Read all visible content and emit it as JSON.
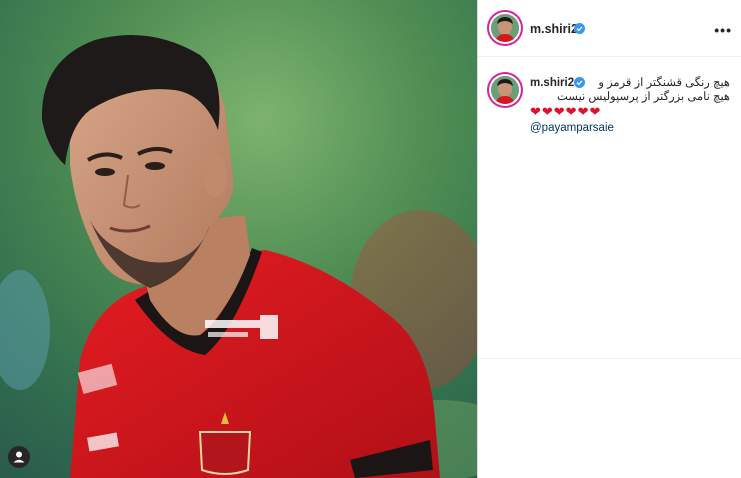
{
  "post": {
    "username": "m.shiri2",
    "caption_line1": "هیچ رنگی قشنگتر از قرمز و",
    "caption_line2": "هیچ نامی بزرگتر از پرسپولیس نیست",
    "hearts": "❤❤❤❤❤❤",
    "mention": "@payamparsaie",
    "more_label": "•••",
    "verified_color": "#3897f0",
    "jersey_color": "#d8161c"
  },
  "icons": {
    "more": "more-options-icon",
    "verified": "verified-badge-icon",
    "tag": "user-tag-icon"
  }
}
